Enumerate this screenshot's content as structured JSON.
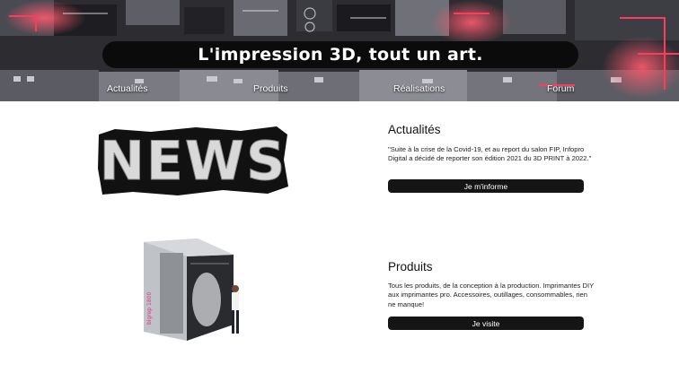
{
  "hero": {
    "title": "L'impression 3D, tout un art."
  },
  "nav": {
    "items": [
      "Actualités",
      "Produits",
      "Réalisations",
      "Forum"
    ]
  },
  "news_section": {
    "image_text": "NEWS",
    "title": "Actualités",
    "text": "\"Suite à la crise de la Covid-19, et au report du salon FIP, Infopro Digital a décidé de reporter son édition 2021 du 3D PRINT à 2022.\"",
    "button_label": "Je m'informe"
  },
  "products_section": {
    "image_label": "bigrep 1800",
    "title": "Produits",
    "text": "Tous les produits, de la conception à la production. Imprimantes DIY aux imprimantes pro. Accessoires, outillages, consommables, rien ne manque!",
    "button_label": "Je visite"
  },
  "colors": {
    "accent": "#ff3b5c",
    "button_bg": "#151515"
  }
}
